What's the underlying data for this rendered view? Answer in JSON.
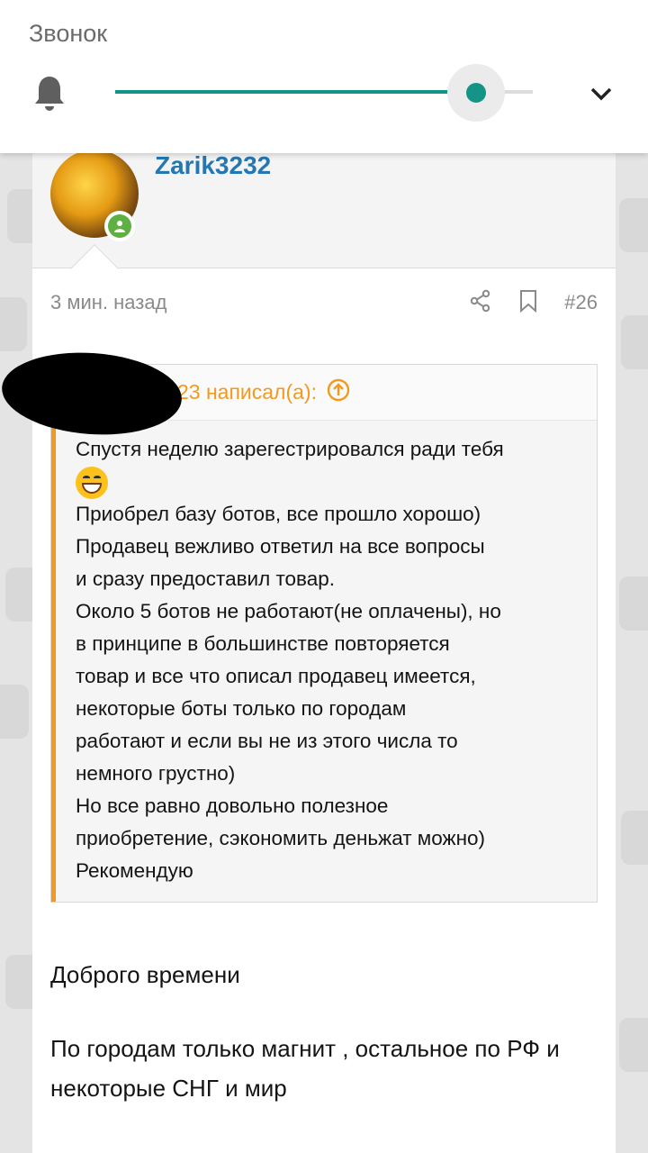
{
  "volume": {
    "title": "Звонок",
    "level": 0.86,
    "accent_color": "#139487",
    "bell_icon": "bell-icon",
    "expand_icon": "chevron-down-icon"
  },
  "post": {
    "username": "Zarik3232",
    "online_badge_icon": "user-online-icon",
    "time": "3 мин. назад",
    "number": "#26",
    "share_icon": "share-icon",
    "bookmark_icon": "bookmark-icon",
    "quote": {
      "author_suffix": "23 написал(а):",
      "jump_icon": "arrow-up-circle-icon",
      "accent_color": "#f39a1e",
      "lines": [
        "Спустя неделю зарегестрировался ради тебя",
        "Приобрел базу ботов, все прошло хорошо)",
        "Продавец вежливо ответил на все вопросы",
        "и сразу предоставил товар.",
        "Около 5 ботов не работают(не оплачены), но",
        "в принципе в большинстве повторяется",
        "товар и все что описал продавец имеется,",
        "некоторые боты только по городам",
        "работают и если вы не из этого числа то",
        "немного грустно)",
        "Но все равно довольно полезное",
        "приобретение, сэкономить деньжат можно)",
        "Рекомендую"
      ]
    },
    "reply": [
      "Доброго времени",
      "По городам только магнит , остальное по РФ и некоторые СНГ и мир"
    ]
  }
}
